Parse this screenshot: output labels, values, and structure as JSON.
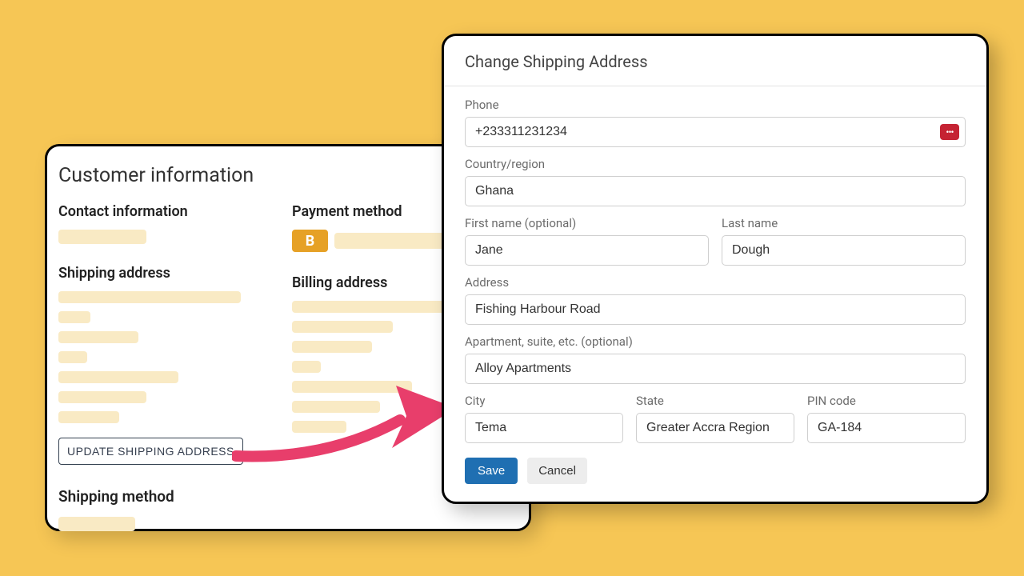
{
  "back": {
    "title": "Customer information",
    "contact_heading": "Contact information",
    "payment_heading": "Payment method",
    "payment_badge": "B",
    "shipping_heading": "Shipping address",
    "billing_heading": "Billing address",
    "update_button_label": "UPDATE SHIPPING ADDRESS",
    "shipping_method_heading": "Shipping method"
  },
  "modal": {
    "title": "Change Shipping Address",
    "labels": {
      "phone": "Phone",
      "country": "Country/region",
      "first_name": "First name (optional)",
      "last_name": "Last name",
      "address": "Address",
      "apartment": "Apartment, suite, etc. (optional)",
      "city": "City",
      "state": "State",
      "pin": "PIN code"
    },
    "values": {
      "phone": "+233311231234",
      "country": "Ghana",
      "first_name": "Jane",
      "last_name": "Dough",
      "address": "Fishing Harbour Road",
      "apartment": "Alloy Apartments",
      "city": "Tema",
      "state": "Greater Accra Region",
      "pin": "GA-184"
    },
    "actions": {
      "save": "Save",
      "cancel": "Cancel"
    }
  }
}
